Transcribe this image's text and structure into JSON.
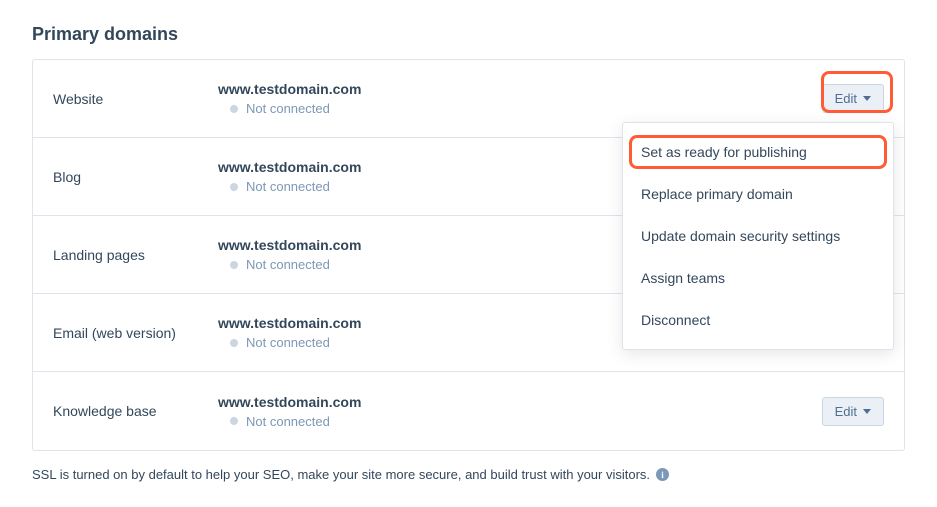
{
  "section_title": "Primary domains",
  "edit_label": "Edit",
  "rows": [
    {
      "label": "Website",
      "domain": "www.testdomain.com",
      "status": "Not connected",
      "show_edit": true,
      "show_dropdown": true,
      "highlight_edit": true
    },
    {
      "label": "Blog",
      "domain": "www.testdomain.com",
      "status": "Not connected",
      "show_edit": false,
      "show_dropdown": false,
      "highlight_edit": false
    },
    {
      "label": "Landing pages",
      "domain": "www.testdomain.com",
      "status": "Not connected",
      "show_edit": false,
      "show_dropdown": false,
      "highlight_edit": false
    },
    {
      "label": "Email (web version)",
      "domain": "www.testdomain.com",
      "status": "Not connected",
      "show_edit": false,
      "show_dropdown": false,
      "highlight_edit": false
    },
    {
      "label": "Knowledge base",
      "domain": "www.testdomain.com",
      "status": "Not connected",
      "show_edit": true,
      "show_dropdown": false,
      "highlight_edit": false
    }
  ],
  "dropdown_items": [
    {
      "label": "Set as ready for publishing",
      "highlight": true
    },
    {
      "label": "Replace primary domain",
      "highlight": false
    },
    {
      "label": "Update domain security settings",
      "highlight": false
    },
    {
      "label": "Assign teams",
      "highlight": false
    },
    {
      "label": "Disconnect",
      "highlight": false
    }
  ],
  "footer_text": "SSL is turned on by default to help your SEO, make your site more secure, and build trust with your visitors."
}
